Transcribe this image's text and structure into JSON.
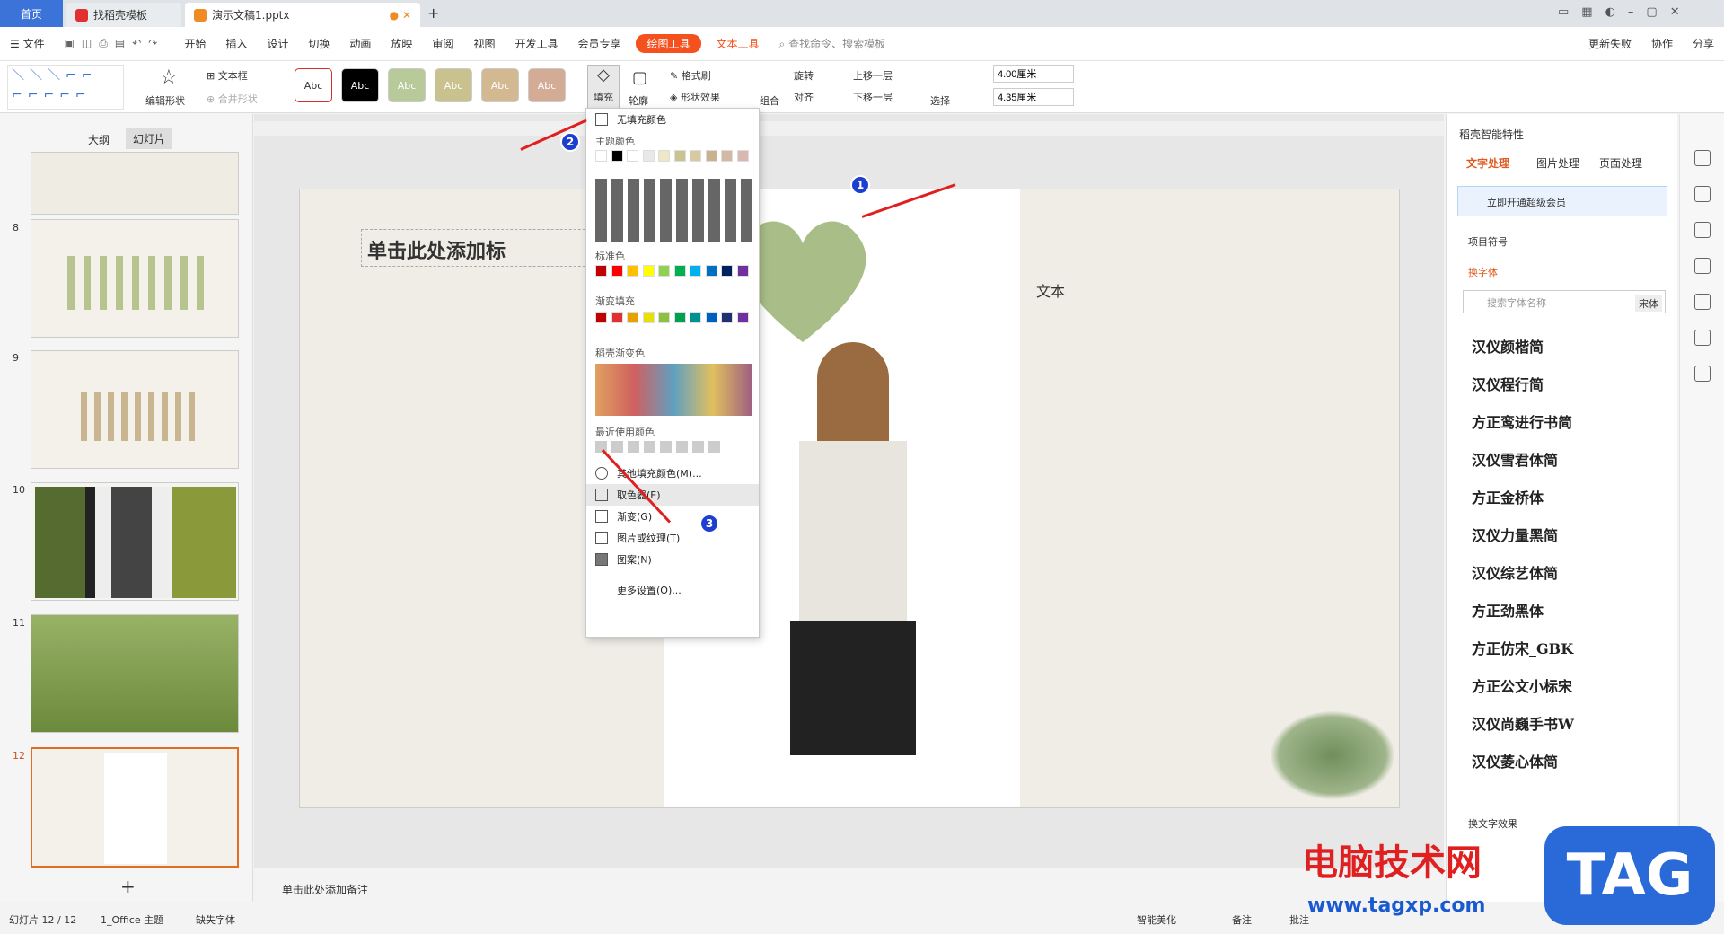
{
  "tabs": {
    "home": "首页",
    "template": "找稻壳模板",
    "doc": "演示文稿1.pptx"
  },
  "menu": {
    "file": "文件",
    "items": [
      "开始",
      "插入",
      "设计",
      "切换",
      "动画",
      "放映",
      "审阅",
      "视图",
      "开发工具",
      "会员专享"
    ],
    "drawing_tools": "绘图工具",
    "text_tools": "文本工具",
    "search": "查找命令、搜索模板",
    "update": "更新失败",
    "collab": "协作",
    "share": "分享"
  },
  "toolbar": {
    "edit_shape": "编辑形状",
    "textbox": "文本框",
    "merge_shape": "合并形状",
    "style_abc": "Abc",
    "fill": "填充",
    "outline": "轮廓",
    "format_painter": "格式刷",
    "shape_effect": "形状效果",
    "rotate": "旋转",
    "align": "对齐",
    "group": "组合",
    "bring_forward": "上移一层",
    "send_backward": "下移一层",
    "select": "选择",
    "width": "4.00厘米",
    "height": "4.35厘米"
  },
  "left_panel": {
    "outline_tab": "大纲",
    "slides_tab": "幻灯片",
    "slide_numbers": [
      "8",
      "9",
      "10",
      "11",
      "12"
    ],
    "add": "+"
  },
  "slide": {
    "title_placeholder": "单击此处添加标",
    "text_placeholder": "文本",
    "notes": "单击此处添加备注"
  },
  "dropdown": {
    "no_fill": "无填充颜色",
    "theme_colors": "主题颜色",
    "standard_colors": "标准色",
    "gradient_fill": "渐变填充",
    "daoke_gradient": "稻壳渐变色",
    "recent_colors": "最近使用颜色",
    "more_colors": "其他填充颜色(M)...",
    "eyedropper": "取色器(E)",
    "gradient": "渐变(G)",
    "picture_texture": "图片或纹理(T)",
    "pattern": "图案(N)",
    "more_settings": "更多设置(O)...",
    "theme_row": [
      "#ffffff",
      "#000000",
      "#ffffff",
      "#e8e8e8",
      "#efe8c8",
      "#c9c48f",
      "#d8c9a3",
      "#c9b38f",
      "#d4b8a6",
      "#d8b8b0"
    ],
    "standard": [
      "#c00000",
      "#ff0000",
      "#ffc000",
      "#ffff00",
      "#92d050",
      "#00b050",
      "#00b0f0",
      "#0070c0",
      "#002060",
      "#7030a0"
    ],
    "gradient_row": [
      "#c00000",
      "#e03030",
      "#e8a000",
      "#e8e000",
      "#8cc040",
      "#00a050",
      "#009090",
      "#0060c0",
      "#203070",
      "#7030a0"
    ]
  },
  "right_panel": {
    "title": "稻壳智能特性",
    "tabs": [
      "文字处理",
      "图片处理",
      "页面处理"
    ],
    "vip": "立即开通超级会员",
    "bullets": "项目符号",
    "change_font": "换字体",
    "search_font": "搜索字体名称",
    "font_current": "宋体",
    "fonts": [
      "汉仪颜楷简",
      "汉仪程行简",
      "方正鸾进行书简",
      "汉仪雪君体简",
      "方正金桥体",
      "汉仪力量黑简",
      "汉仪综艺体简",
      "方正劲黑体",
      "方正仿宋_GBK",
      "方正公文小标宋",
      "汉仪尚巍手书W",
      "汉仪菱心体简"
    ],
    "text_effect": "换文字效果"
  },
  "status": {
    "slide": "幻灯片 12 / 12",
    "theme": "1_Office 主题",
    "missing_font": "缺失字体",
    "beautify": "智能美化",
    "notes": "备注",
    "comment": "批注"
  },
  "badges": [
    "1",
    "2",
    "3"
  ],
  "watermark": {
    "site": "电脑技术网",
    "url": "www.tagxp.com",
    "tag": "TAG"
  }
}
